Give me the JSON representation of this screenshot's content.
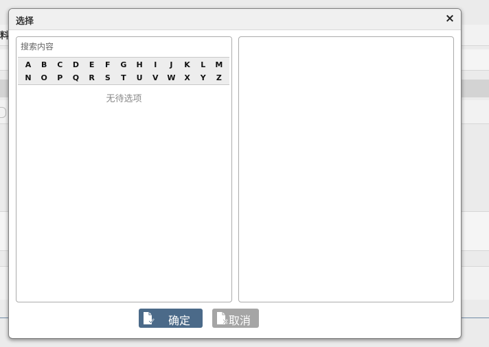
{
  "dialog": {
    "title": "选择",
    "close_symbol": "×"
  },
  "left_panel": {
    "search_placeholder": "搜索内容",
    "letters_row1": [
      "A",
      "B",
      "C",
      "D",
      "E",
      "F",
      "G",
      "H",
      "I",
      "J",
      "K",
      "L",
      "M"
    ],
    "letters_row2": [
      "N",
      "O",
      "P",
      "Q",
      "R",
      "S",
      "T",
      "U",
      "V",
      "W",
      "X",
      "Y",
      "Z"
    ],
    "empty_text": "无待选项"
  },
  "buttons": {
    "confirm_label": "确定",
    "confirm_icon": "document-check-icon",
    "cancel_label": "取消",
    "cancel_icon": "document-x-icon"
  },
  "background": {
    "partial_label": "料"
  },
  "colors": {
    "confirm_bg": "#4b6a89",
    "cancel_bg": "#a5a5a5"
  }
}
